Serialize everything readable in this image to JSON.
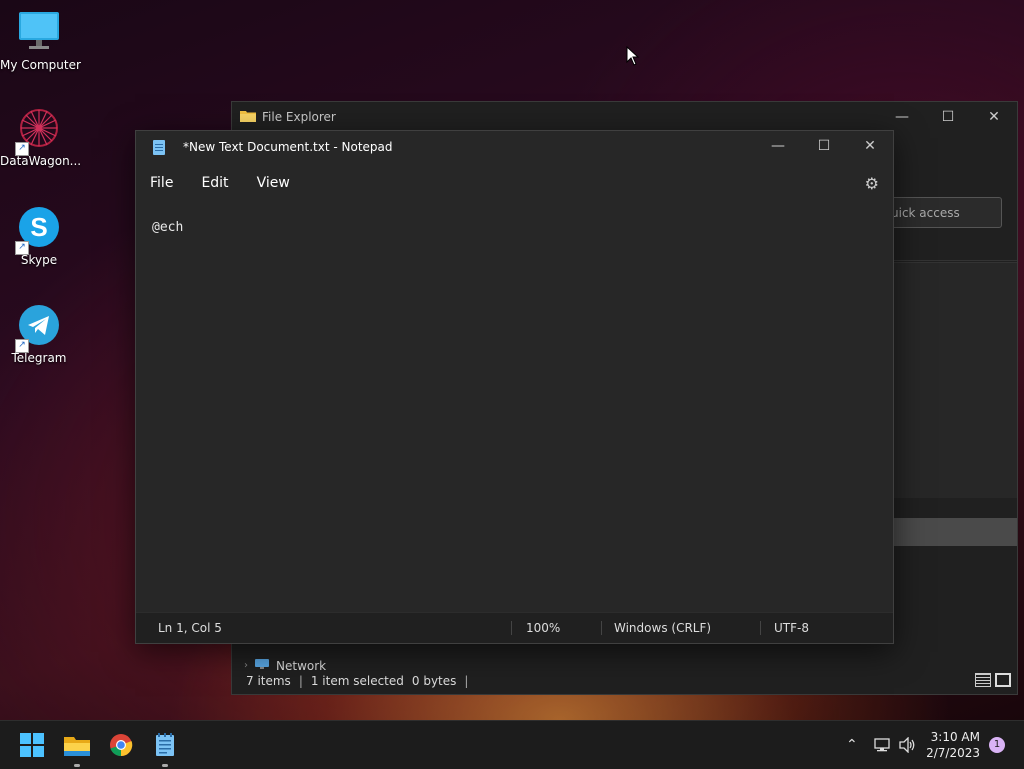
{
  "desktop": {
    "icons": [
      {
        "label": "My Computer"
      },
      {
        "label": "DataWagon..."
      },
      {
        "label": "Skype"
      },
      {
        "label": "Telegram"
      }
    ]
  },
  "explorer": {
    "title": "File Explorer",
    "search_placeholder": "uick access",
    "nav_network": "Network",
    "status": {
      "items": "7 items",
      "selected": "1 item selected",
      "size": "0 bytes"
    }
  },
  "notepad": {
    "title": "*New Text Document.txt - Notepad",
    "menu": {
      "file": "File",
      "edit": "Edit",
      "view": "View"
    },
    "content": "@ech",
    "status": {
      "position": "Ln 1, Col 5",
      "zoom": "100%",
      "line_endings": "Windows (CRLF)",
      "encoding": "UTF-8"
    }
  },
  "taskbar": {
    "time": "3:10 AM",
    "date": "2/7/2023",
    "notification_count": "1"
  },
  "colors": {
    "accent": "#0078d4",
    "chrome_yellow": "#fbc02d"
  }
}
